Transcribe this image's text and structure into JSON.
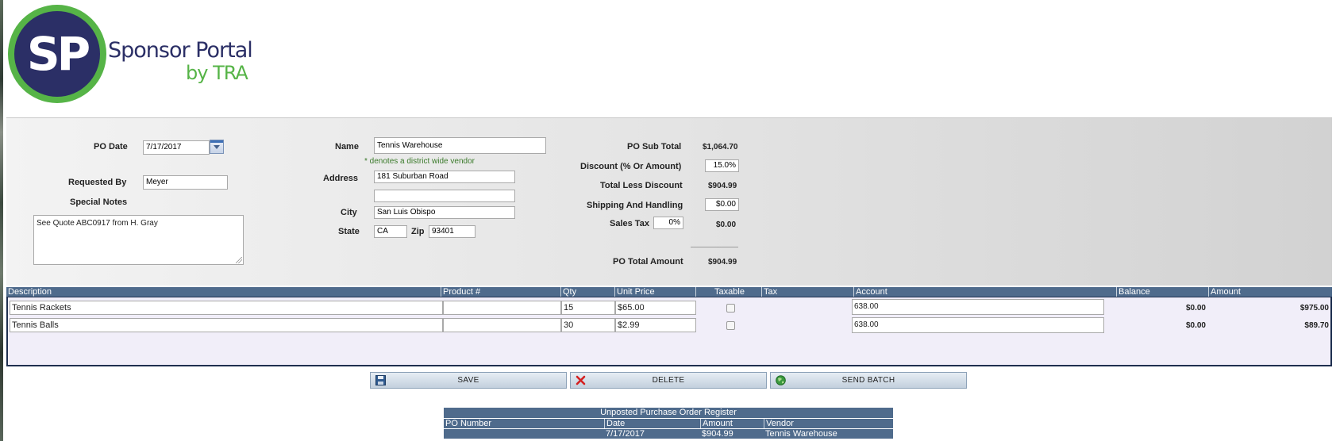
{
  "logo": {
    "mark": "SP",
    "title": "Sponsor Portal",
    "subtitle": "by TRA"
  },
  "form": {
    "po_date": {
      "label": "PO Date",
      "value": "7/17/2017"
    },
    "requested_by": {
      "label": "Requested By",
      "value": "Meyer"
    },
    "special_notes": {
      "label": "Special Notes",
      "value": "See Quote ABC0917 from H. Gray"
    },
    "name": {
      "label": "Name",
      "value": "Tennis Warehouse"
    },
    "district_note": "* denotes a district wide vendor",
    "address": {
      "label": "Address",
      "line1": "181 Suburban Road",
      "line2": ""
    },
    "city": {
      "label": "City",
      "value": "San Luis Obispo"
    },
    "state": {
      "label": "State",
      "value": "CA"
    },
    "zip": {
      "label": "Zip",
      "value": "93401"
    }
  },
  "totals": {
    "subtotal": {
      "label": "PO Sub Total",
      "value": "$1,064.70"
    },
    "discount": {
      "label": "Discount (% Or Amount)",
      "value": "15.0%"
    },
    "total_less_discount": {
      "label": "Total Less Discount",
      "value": "$904.99"
    },
    "shipping": {
      "label": "Shipping And Handling",
      "value": "$0.00"
    },
    "sales_tax": {
      "label": "Sales Tax",
      "rate": "0%",
      "value": "$0.00"
    },
    "po_total": {
      "label": "PO Total Amount",
      "value": "$904.99"
    }
  },
  "items": {
    "columns": [
      "Description",
      "Product #",
      "Qty",
      "Unit Price",
      "Taxable",
      "Tax",
      "Account",
      "Balance",
      "Amount"
    ],
    "rows": [
      {
        "description": "Tennis Rackets",
        "product": "",
        "qty": "15",
        "unit_price": "$65.00",
        "taxable": false,
        "tax": "",
        "account": "638.00",
        "balance": "$0.00",
        "amount": "$975.00"
      },
      {
        "description": "Tennis Balls",
        "product": "",
        "qty": "30",
        "unit_price": "$2.99",
        "taxable": false,
        "tax": "",
        "account": "638.00",
        "balance": "$0.00",
        "amount": "$89.70"
      }
    ]
  },
  "actions": {
    "save": "SAVE",
    "delete": "DELETE",
    "send_batch": "SEND BATCH"
  },
  "register": {
    "title": "Unposted Purchase Order Register",
    "columns": [
      "PO Number",
      "Date",
      "Amount",
      "Vendor"
    ],
    "rows": [
      {
        "po_number": "",
        "date": "7/17/2017",
        "amount": "$904.99",
        "vendor": "Tennis Warehouse"
      }
    ]
  },
  "colors": {
    "header_blue": "#4f6b8c",
    "brand_navy": "#2b2f66",
    "brand_green": "#56b447"
  }
}
